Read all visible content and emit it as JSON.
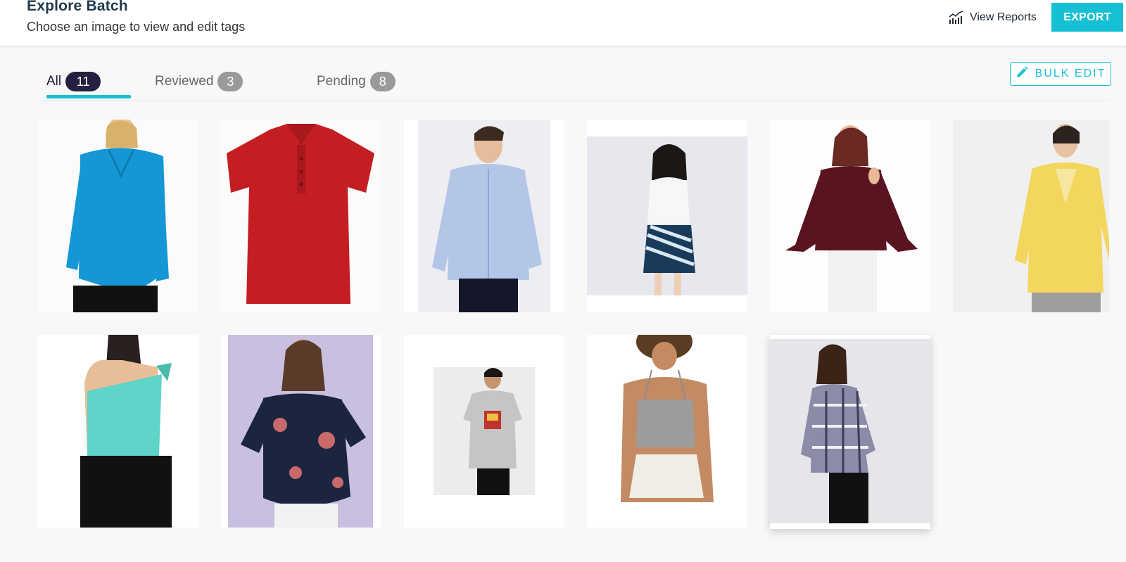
{
  "header": {
    "title": "Explore Batch",
    "subtitle": "Choose an image to view and edit tags",
    "view_reports_label": "View Reports",
    "export_label": "EXPORT"
  },
  "tabs": [
    {
      "label": "All",
      "count": "11",
      "active": true
    },
    {
      "label": "Reviewed",
      "count": "3",
      "active": false
    },
    {
      "label": "Pending",
      "count": "8",
      "active": false
    }
  ],
  "bulk_edit_label": "BULK EDIT",
  "images": [
    {
      "item": "blue wrap blouse",
      "color": "#1597d6"
    },
    {
      "item": "red polo shirt",
      "color": "#c41e22"
    },
    {
      "item": "light blue oxford shirt",
      "color": "#b3c6e8"
    },
    {
      "item": "white tank with striped skirt",
      "color": "#f4f4f4"
    },
    {
      "item": "maroon cold-shoulder bell-sleeve top",
      "color": "#5a1420"
    },
    {
      "item": "yellow sweater",
      "color": "#f2d65e"
    },
    {
      "item": "mint one-shoulder top",
      "color": "#5fd4c8"
    },
    {
      "item": "navy floral blouse",
      "color": "#1c2540"
    },
    {
      "item": "grey graphic tee",
      "color": "#c5c5c5"
    },
    {
      "item": "grey ribbed cami",
      "color": "#9c9c9c"
    },
    {
      "item": "plaid blouse",
      "color": "#8a8ca8"
    }
  ],
  "colors": {
    "accent": "#16c0d4",
    "active_badge": "#24203f",
    "inactive_badge": "#9a9a9a",
    "title": "#1e3a4c"
  }
}
